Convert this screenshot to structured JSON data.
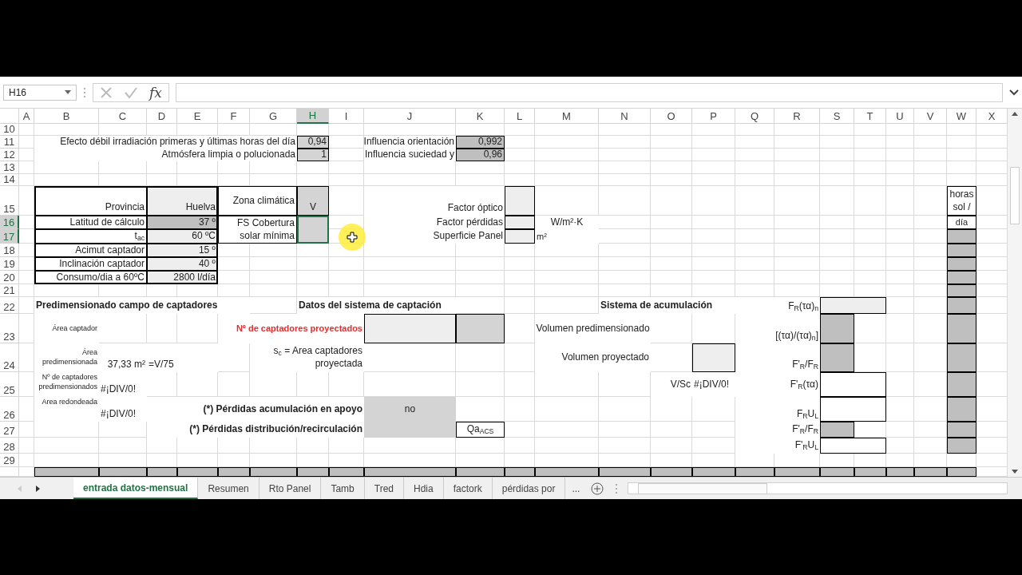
{
  "name_box": "H16",
  "function_button": "fx",
  "columns": [
    {
      "label": "A",
      "selected": false
    },
    {
      "label": "B",
      "selected": false
    },
    {
      "label": "C",
      "selected": false
    },
    {
      "label": "D",
      "selected": false
    },
    {
      "label": "E",
      "selected": false
    },
    {
      "label": "F",
      "selected": false
    },
    {
      "label": "G",
      "selected": false
    },
    {
      "label": "H",
      "selected": true
    },
    {
      "label": "I",
      "selected": false
    },
    {
      "label": "J",
      "selected": false
    },
    {
      "label": "K",
      "selected": false
    },
    {
      "label": "L",
      "selected": false
    },
    {
      "label": "M",
      "selected": false
    },
    {
      "label": "N",
      "selected": false
    },
    {
      "label": "O",
      "selected": false
    },
    {
      "label": "P",
      "selected": false
    },
    {
      "label": "Q",
      "selected": false
    },
    {
      "label": "R",
      "selected": false
    },
    {
      "label": "S",
      "selected": false
    },
    {
      "label": "T",
      "selected": false
    },
    {
      "label": "U",
      "selected": false
    },
    {
      "label": "V",
      "selected": false
    },
    {
      "label": "W",
      "selected": false
    },
    {
      "label": "X",
      "selected": false
    }
  ],
  "rows": [
    {
      "number": "10",
      "selected": false
    },
    {
      "number": "11",
      "selected": false
    },
    {
      "number": "12",
      "selected": false
    },
    {
      "number": "13",
      "selected": false
    },
    {
      "number": "14",
      "selected": false
    },
    {
      "number": "15",
      "selected": false
    },
    {
      "number": "16",
      "selected": true
    },
    {
      "number": "17",
      "selected": true
    },
    {
      "number": "18",
      "selected": false
    },
    {
      "number": "19",
      "selected": false
    },
    {
      "number": "20",
      "selected": false
    },
    {
      "number": "21",
      "selected": false
    },
    {
      "number": "22",
      "selected": false
    },
    {
      "number": "23",
      "selected": false
    },
    {
      "number": "24",
      "selected": false
    },
    {
      "number": "25",
      "selected": false
    },
    {
      "number": "26",
      "selected": false
    },
    {
      "number": "27",
      "selected": false
    },
    {
      "number": "28",
      "selected": false
    },
    {
      "number": "29",
      "selected": false
    }
  ],
  "cells": [
    {
      "text": "Efecto débil irradiación primeras y últimas horas del día"
    },
    {
      "text": "0,94"
    },
    {
      "text": "Influencia orientación"
    },
    {
      "text": "0,992"
    },
    {
      "text": "Atmósfera limpia o polucionada"
    },
    {
      "text": "1"
    },
    {
      "text": "Influencia suciedad y"
    },
    {
      "text": "0,96"
    },
    {
      "text": "Provincia"
    },
    {
      "text": "Huelva"
    },
    {
      "text": "Zona climática"
    },
    {
      "text": "V"
    },
    {
      "text": "Factor óptico"
    },
    {
      "text": "horas sol /"
    },
    {
      "text": "Latitud de cálculo"
    },
    {
      "text": "37 º"
    },
    {
      "text": "FS Cobertura solar mínima"
    },
    {
      "text": "Factor pérdidas"
    },
    {
      "text": "W/m²·K"
    },
    {
      "text": "día"
    },
    {
      "text": "t$_{ac}$"
    },
    {
      "text": "60 ºC"
    },
    {
      "text": "Superficie Panel"
    },
    {
      "text": "m²"
    },
    {
      "text": "Acimut captador"
    },
    {
      "text": "15 º"
    },
    {
      "text": "Inclinación captador"
    },
    {
      "text": "40 º"
    },
    {
      "text": "Consumo/dia a 60ºC"
    },
    {
      "text": "2800 l/día"
    },
    {
      "text": "Predimensionado campo de captadores"
    },
    {
      "text": "Datos del sistema de captación"
    },
    {
      "text": "Sistema de acumulación"
    },
    {
      "text": "F$_{R}$(τα)$_{n}$"
    },
    {
      "text": "Área captador"
    },
    {
      "text": "Nº de captadores proyectados"
    },
    {
      "text": "Volumen predimensionado"
    },
    {
      "text": "[(τα)/(τα)$_{n}$]"
    },
    {
      "text": "Área predimensionada"
    },
    {
      "text": "37,33 m²"
    },
    {
      "text": "=V/75"
    },
    {
      "text": "s$_{c}$ = Area captadores proyectada"
    },
    {
      "text": "Volumen proyectado"
    },
    {
      "text": "F'$_{R}$/F$_{R}$"
    },
    {
      "text": "Nº de captadores predimensionados"
    },
    {
      "text": "#¡DIV/0!"
    },
    {
      "text": "V/Sc"
    },
    {
      "text": "#¡DIV/0!"
    },
    {
      "text": "F'$_{R}$(τα)"
    },
    {
      "text": "Area redondeada"
    },
    {
      "text": "#¡DIV/0!"
    },
    {
      "text": "(*) Pérdidas acumulación en apoyo"
    },
    {
      "text": "no"
    },
    {
      "text": "F$_{R}$U$_{L}$"
    },
    {
      "text": "(*) Pérdidas distribución/recirculación"
    },
    {
      "text": "Qa$_{ACS}$"
    },
    {
      "text": "F'$_{R}$/F$_{R}$"
    },
    {
      "text": "F'$_{R}$U$_{L}$"
    }
  ],
  "sheet_tabs": [
    {
      "label": "entrada datos-mensual",
      "selected": true
    },
    {
      "label": "Resumen",
      "selected": false
    },
    {
      "label": "Rto Panel",
      "selected": false
    },
    {
      "label": "Tamb",
      "selected": false
    },
    {
      "label": "Tred",
      "selected": false
    },
    {
      "label": "Hdia",
      "selected": false
    },
    {
      "label": "factork",
      "selected": false
    },
    {
      "label": "pérdidas por",
      "selected": false
    }
  ],
  "more_tabs": "..."
}
